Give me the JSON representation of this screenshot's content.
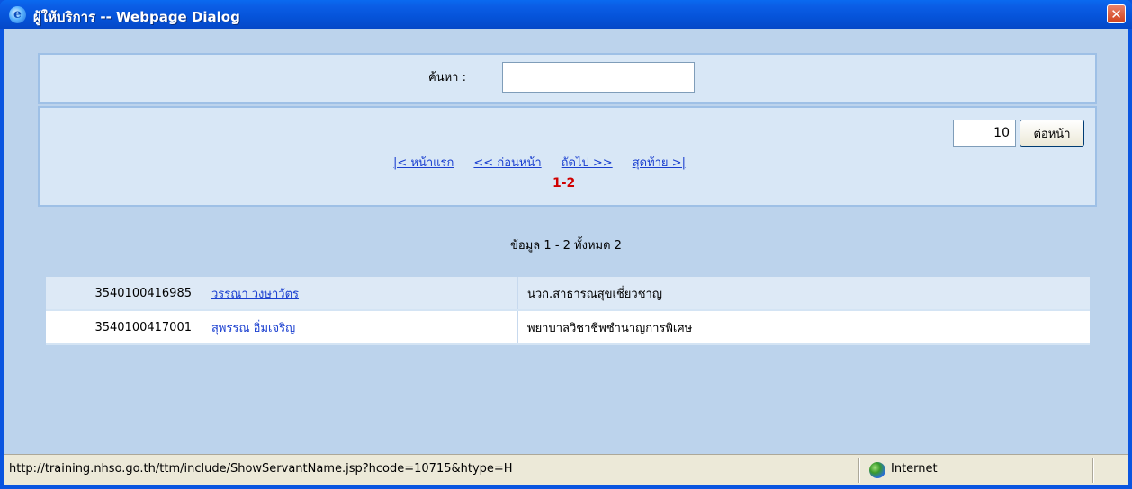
{
  "window": {
    "title": "ผู้ให้บริการ -- Webpage Dialog",
    "close_glyph": "✕"
  },
  "search": {
    "label": "ค้นหา :",
    "value": ""
  },
  "pager": {
    "per_page_value": "10",
    "per_page_button": "ต่อหน้า",
    "first": "|< หน้าแรก",
    "prev": "<< ก่อนหน้า",
    "next": "ถัดไป >>",
    "last": "สุดท้าย >|",
    "range": "1-2"
  },
  "summary": "ข้อมูล 1 - 2 ทั้งหมด 2",
  "rows": [
    {
      "pid": "3540100416985",
      "name": "วรรณา วงษาวัตร",
      "position": "นวก.สาธารณสุขเชี่ยวชาญ"
    },
    {
      "pid": "3540100417001",
      "name": "สุพรรณ อิ่มเจริญ",
      "position": "พยาบาลวิชาชีพชำนาญการพิเศษ"
    }
  ],
  "statusbar": {
    "url": "http://training.nhso.go.th/ttm/include/ShowServantName.jsp?hcode=10715&htype=H",
    "zone": "Internet"
  },
  "icons": {
    "title": "ie-icon",
    "zone": "globe-icon"
  }
}
